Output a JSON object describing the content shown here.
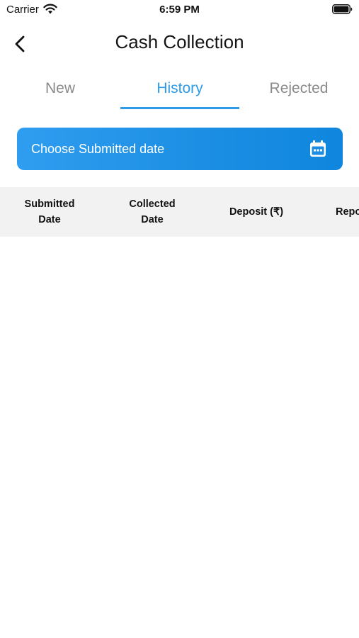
{
  "status_bar": {
    "carrier": "Carrier",
    "time": "6:59 PM",
    "icons": [
      "wifi-icon",
      "battery-icon"
    ]
  },
  "header": {
    "back_icon": "chevron-left-icon",
    "title": "Cash Collection"
  },
  "tabs": [
    {
      "label": "New",
      "active": false
    },
    {
      "label": "History",
      "active": true
    },
    {
      "label": "Rejected",
      "active": false
    }
  ],
  "date_filter": {
    "placeholder": "Choose Submitted date",
    "icon": "calendar-icon"
  },
  "table": {
    "columns": [
      "Submitted\nDate",
      "Collected\nDate",
      "Deposit (₹)",
      "Report"
    ],
    "rows": []
  },
  "colors": {
    "accent": "#2d9be6",
    "button_gradient_start": "#2f9df0",
    "button_gradient_end": "#0f86dd",
    "inactive_tab": "#8a8a8a",
    "table_header_bg": "#f2f2f2"
  }
}
